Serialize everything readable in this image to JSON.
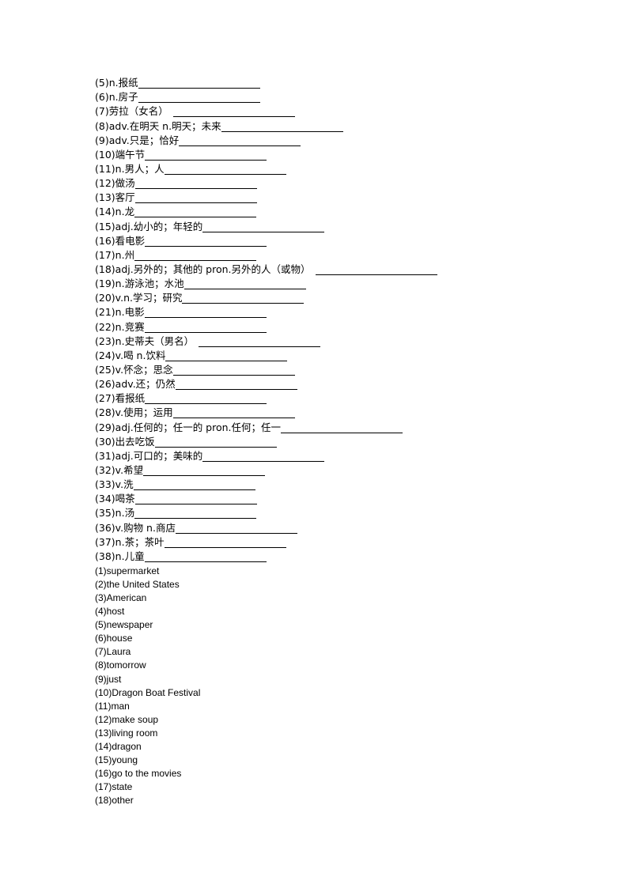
{
  "questions": [
    {
      "num": "(5)",
      "text": "n.报纸",
      "gap": false
    },
    {
      "num": "(6)",
      "text": "n.房子",
      "gap": false
    },
    {
      "num": "(7)",
      "text": "劳拉（女名）",
      "gap": true
    },
    {
      "num": "(8)",
      "text": "adv.在明天  n.明天；未来",
      "gap": false
    },
    {
      "num": "(9)",
      "text": "adv.只是；恰好",
      "gap": false
    },
    {
      "num": "(10)",
      "text": "端午节",
      "gap": false
    },
    {
      "num": "(11)",
      "text": "n.男人；人",
      "gap": false
    },
    {
      "num": "(12)",
      "text": "做汤",
      "gap": false
    },
    {
      "num": "(13)",
      "text": "客厅",
      "gap": false
    },
    {
      "num": "(14)",
      "text": "n.龙",
      "gap": false
    },
    {
      "num": "(15)",
      "text": "adj.幼小的；年轻的",
      "gap": false
    },
    {
      "num": "(16)",
      "text": "看电影",
      "gap": false
    },
    {
      "num": "(17)",
      "text": "n.州",
      "gap": false
    },
    {
      "num": "(18)",
      "text": "adj.另外的；其他的  pron.另外的人（或物）",
      "gap": true
    },
    {
      "num": "(19)",
      "text": "n.游泳池；水池",
      "gap": false
    },
    {
      "num": "(20)",
      "text": "v.n.学习；研究",
      "gap": false
    },
    {
      "num": "(21)",
      "text": "n.电影",
      "gap": false
    },
    {
      "num": "(22)",
      "text": "n.竞赛",
      "gap": false
    },
    {
      "num": "(23)",
      "text": "n.史蒂夫（男名）",
      "gap": true
    },
    {
      "num": "(24)",
      "text": "v.喝  n.饮料",
      "gap": false
    },
    {
      "num": "(25)",
      "text": "v.怀念；思念",
      "gap": false
    },
    {
      "num": "(26)",
      "text": "adv.还；仍然",
      "gap": false
    },
    {
      "num": "(27)",
      "text": "看报纸",
      "gap": false
    },
    {
      "num": "(28)",
      "text": "v.使用；运用",
      "gap": false
    },
    {
      "num": "(29)",
      "text": "adj.任何的；任一的  pron.任何；任一",
      "gap": false
    },
    {
      "num": "(30)",
      "text": "出去吃饭",
      "gap": false
    },
    {
      "num": "(31)",
      "text": "adj.可口的；美味的",
      "gap": false
    },
    {
      "num": "(32)",
      "text": "v.希望",
      "gap": false
    },
    {
      "num": "(33)",
      "text": "v.洗",
      "gap": false
    },
    {
      "num": "(34)",
      "text": "喝茶",
      "gap": false
    },
    {
      "num": "(35)",
      "text": "n.汤",
      "gap": false
    },
    {
      "num": "(36)",
      "text": "v.购物  n.商店",
      "gap": false
    },
    {
      "num": "(37)",
      "text": "n.茶；茶叶",
      "gap": false
    },
    {
      "num": "(38)",
      "text": "n.儿童",
      "gap": false
    }
  ],
  "answers": [
    "(1)supermarket",
    "(2)the United States",
    "(3)American",
    "(4)host",
    "(5)newspaper",
    "(6)house",
    "(7)Laura",
    "(8)tomorrow",
    "(9)just",
    "(10)Dragon Boat Festival",
    "(11)man",
    "(12)make soup",
    "(13)living  room",
    "(14)dragon",
    "(15)young",
    "(16)go  to the movies",
    "(17)state",
    "(18)other"
  ]
}
